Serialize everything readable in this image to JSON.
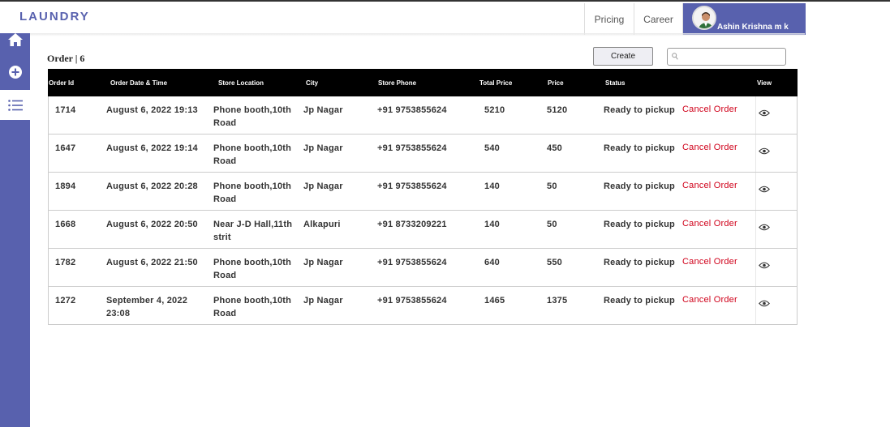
{
  "app": {
    "logo": "LAUNDRY"
  },
  "nav": {
    "pricing": "Pricing",
    "career": "Career",
    "user_name": "Ashin Krishna m k"
  },
  "sidebar": {
    "items": [
      {
        "icon": "home-icon"
      },
      {
        "icon": "plus-circle-icon"
      },
      {
        "icon": "list-icon"
      }
    ]
  },
  "orders": {
    "title": "Order | 6",
    "create_label": "Create",
    "search_value": "",
    "headers": {
      "order_id": "Order Id",
      "order_date": "Order Date & Time",
      "store_location": "Store Location",
      "city": "City",
      "store_phone": "Store Phone",
      "total_price": "Total Price",
      "price": "Price",
      "status": "Status",
      "view": "View"
    },
    "rows": [
      {
        "id": "1714",
        "date": "August 6, 2022 19:13",
        "location": "Phone booth,10th Road",
        "city": "Jp Nagar",
        "phone": "+91 9753855624",
        "total": "5210",
        "price": "5120",
        "status": "Ready to pickup",
        "action": "Cancel Order"
      },
      {
        "id": "1647",
        "date": "August 6, 2022 19:14",
        "location": "Phone booth,10th Road",
        "city": "Jp Nagar",
        "phone": "+91 9753855624",
        "total": "540",
        "price": "450",
        "status": "Ready to pickup",
        "action": "Cancel Order"
      },
      {
        "id": "1894",
        "date": "August 6, 2022 20:28",
        "location": "Phone booth,10th Road",
        "city": "Jp Nagar",
        "phone": "+91 9753855624",
        "total": "140",
        "price": "50",
        "status": "Ready to pickup",
        "action": "Cancel Order"
      },
      {
        "id": "1668",
        "date": "August 6, 2022 20:50",
        "location": "Near J-D Hall,11th strit",
        "city": "Alkapuri",
        "phone": "+91 8733209221",
        "total": "140",
        "price": "50",
        "status": "Ready to pickup",
        "action": "Cancel Order"
      },
      {
        "id": "1782",
        "date": "August 6, 2022 21:50",
        "location": "Phone booth,10th Road",
        "city": "Jp Nagar",
        "phone": "+91 9753855624",
        "total": "640",
        "price": "550",
        "status": "Ready to pickup",
        "action": "Cancel Order"
      },
      {
        "id": "1272",
        "date": "September 4, 2022 23:08",
        "location": "Phone booth,10th Road",
        "city": "Jp Nagar",
        "phone": "+91 9753855624",
        "total": "1465",
        "price": "1375",
        "status": "Ready to pickup",
        "action": "Cancel Order"
      }
    ]
  },
  "colors": {
    "brand": "#5861AE",
    "cancel": "#d0021b",
    "header_bg": "#000000"
  }
}
